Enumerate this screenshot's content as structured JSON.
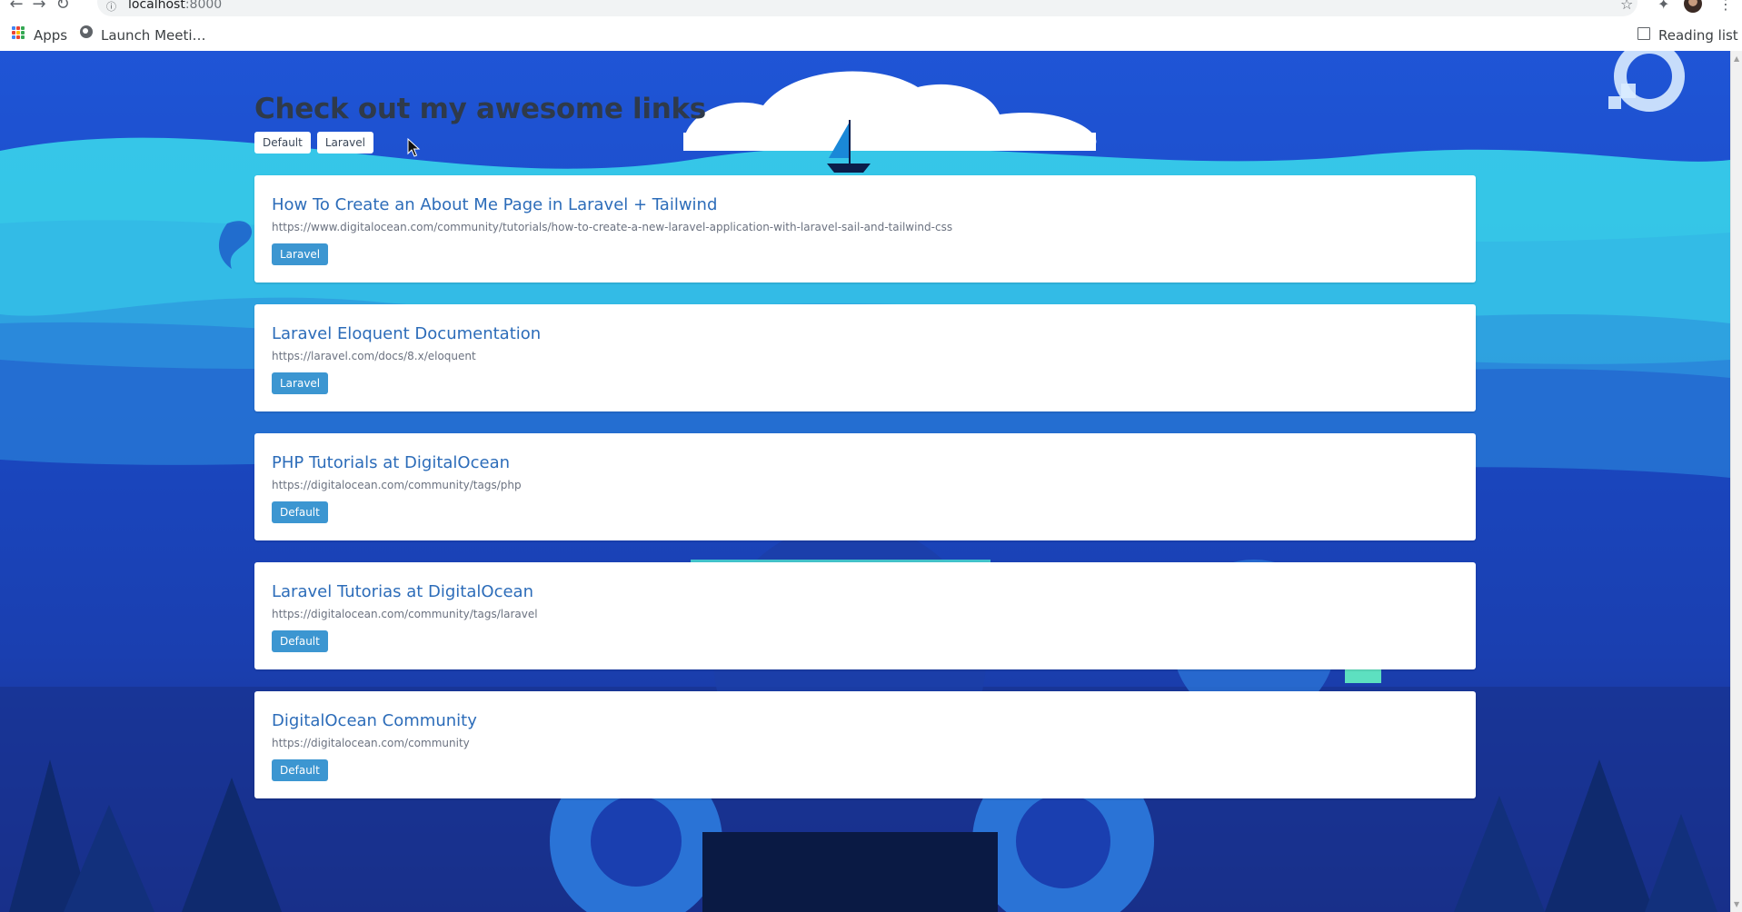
{
  "browser": {
    "url_host": "localhost",
    "url_port": ":8000",
    "bookmarks": {
      "apps_label": "Apps",
      "launch_label": "Launch Meeti…",
      "reading_list_label": "Reading list"
    }
  },
  "page": {
    "title": "Check out my awesome links",
    "filters": [
      "Default",
      "Laravel"
    ]
  },
  "links": [
    {
      "title": "How To Create an About Me Page in Laravel + Tailwind",
      "url": "https://www.digitalocean.com/community/tutorials/how-to-create-a-new-laravel-application-with-laravel-sail-and-tailwind-css",
      "tag": "Laravel"
    },
    {
      "title": "Laravel Eloquent Documentation",
      "url": "https://laravel.com/docs/8.x/eloquent",
      "tag": "Laravel"
    },
    {
      "title": "PHP Tutorials at DigitalOcean",
      "url": "https://digitalocean.com/community/tags/php",
      "tag": "Default"
    },
    {
      "title": "Laravel Tutorias at DigitalOcean",
      "url": "https://digitalocean.com/community/tags/laravel",
      "tag": "Default"
    },
    {
      "title": "DigitalOcean Community",
      "url": "https://digitalocean.com/community",
      "tag": "Default"
    }
  ],
  "colors": {
    "background": "#1b49c4",
    "link_title": "#2c6cb9",
    "tag_background": "#3c96d1",
    "wave": "#39d3ea"
  },
  "icons": [
    "back-arrow-icon",
    "forward-arrow-icon",
    "reload-icon",
    "info-icon",
    "star-icon",
    "extensions-icon",
    "menu-dots-icon",
    "apps-grid-icon",
    "globe-icon",
    "reading-list-icon",
    "digitalocean-logo-icon",
    "sailboat-icon",
    "cursor-icon"
  ]
}
